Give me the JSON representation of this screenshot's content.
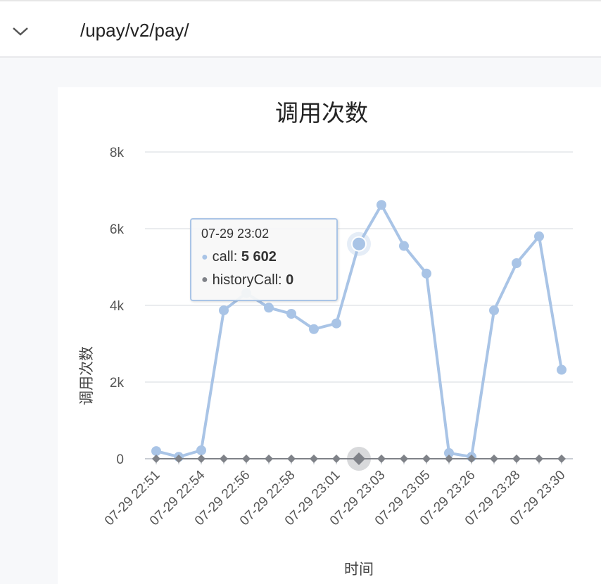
{
  "header": {
    "endpoint": "/upay/v2/pay/",
    "toggle_icon": "chevron-down-icon"
  },
  "chart_data": {
    "type": "line",
    "title": "调用次数",
    "xlabel": "时间",
    "ylabel": "调用次数",
    "ylim": [
      0,
      8000
    ],
    "yticks": [
      "0",
      "2k",
      "4k",
      "6k",
      "8k"
    ],
    "grid": true,
    "categories": [
      "07-29 22:51",
      "",
      "07-29 22:54",
      "",
      "07-29 22:56",
      "",
      "07-29 22:58",
      "",
      "07-29 23:01",
      "",
      "07-29 23:03",
      "",
      "07-29 23:05",
      "",
      "07-29 23:26",
      "",
      "07-29 23:28",
      "",
      "07-29 23:30"
    ],
    "series": [
      {
        "name": "call",
        "color": "#a9c4e6",
        "marker": "circle",
        "values": [
          200,
          50,
          220,
          3870,
          4320,
          3940,
          3780,
          3380,
          3530,
          5602,
          6620,
          5550,
          4830,
          150,
          50,
          3870,
          5100,
          5800,
          2320
        ]
      },
      {
        "name": "historyCall",
        "color": "#7f8288",
        "marker": "diamond",
        "values": [
          0,
          0,
          0,
          0,
          0,
          0,
          0,
          0,
          0,
          0,
          0,
          0,
          0,
          0,
          0,
          0,
          0,
          0,
          0
        ]
      }
    ],
    "tooltip": {
      "title": "07-29 23:02",
      "rows": [
        {
          "series": "call",
          "value": "5 602"
        },
        {
          "series": "historyCall",
          "value": "0"
        }
      ],
      "active_index": 9
    }
  }
}
